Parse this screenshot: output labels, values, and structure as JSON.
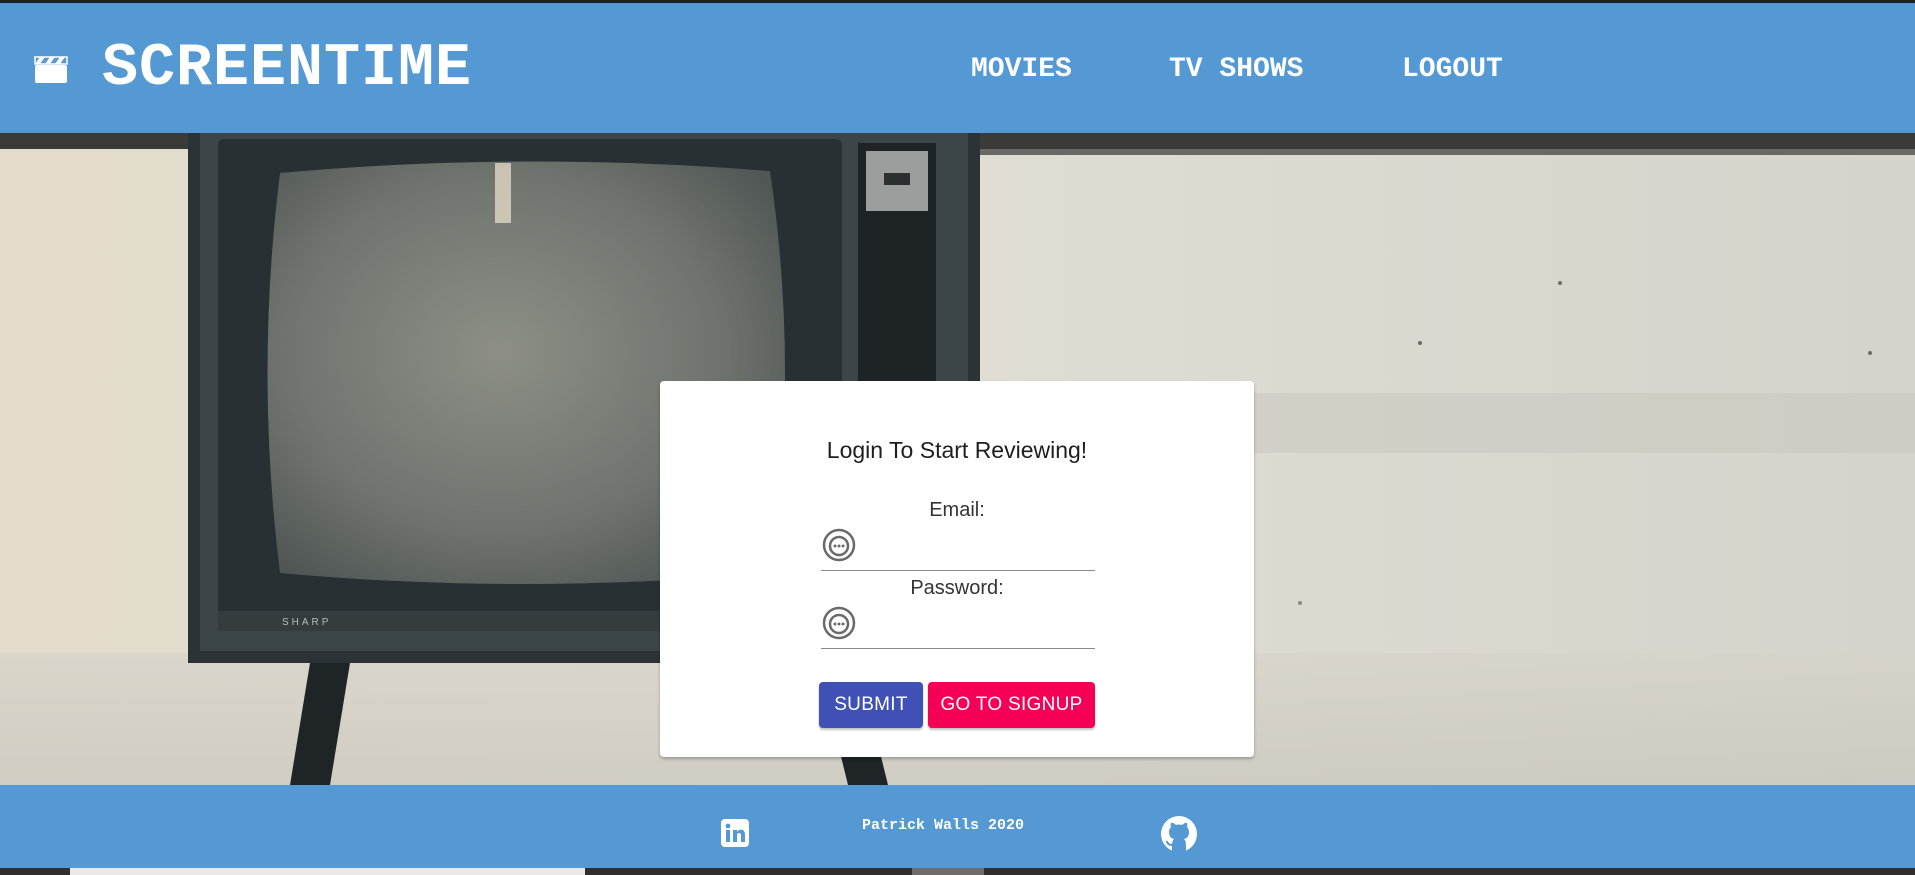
{
  "app": {
    "brand_title": "SCREENTIME",
    "brand_icon": "clapperboard-icon"
  },
  "nav": {
    "movies": "MOVIES",
    "tv_shows": "TV SHOWS",
    "logout": "LOGOUT"
  },
  "login": {
    "title": "Login To Start Reviewing!",
    "email_label": "Email:",
    "email_value": "",
    "password_label": "Password:",
    "password_value": "",
    "password_manager_icon": "password-manager-icon",
    "submit_label": "SUBMIT",
    "signup_label": "GO TO SIGNUP"
  },
  "footer": {
    "text": "Patrick Walls 2020",
    "linkedin_icon": "linkedin-icon",
    "github_icon": "github-icon"
  },
  "colors": {
    "navbar": "#5499d3",
    "submit": "#3f51b5",
    "signup": "#f50057",
    "card": "#ffffff"
  }
}
